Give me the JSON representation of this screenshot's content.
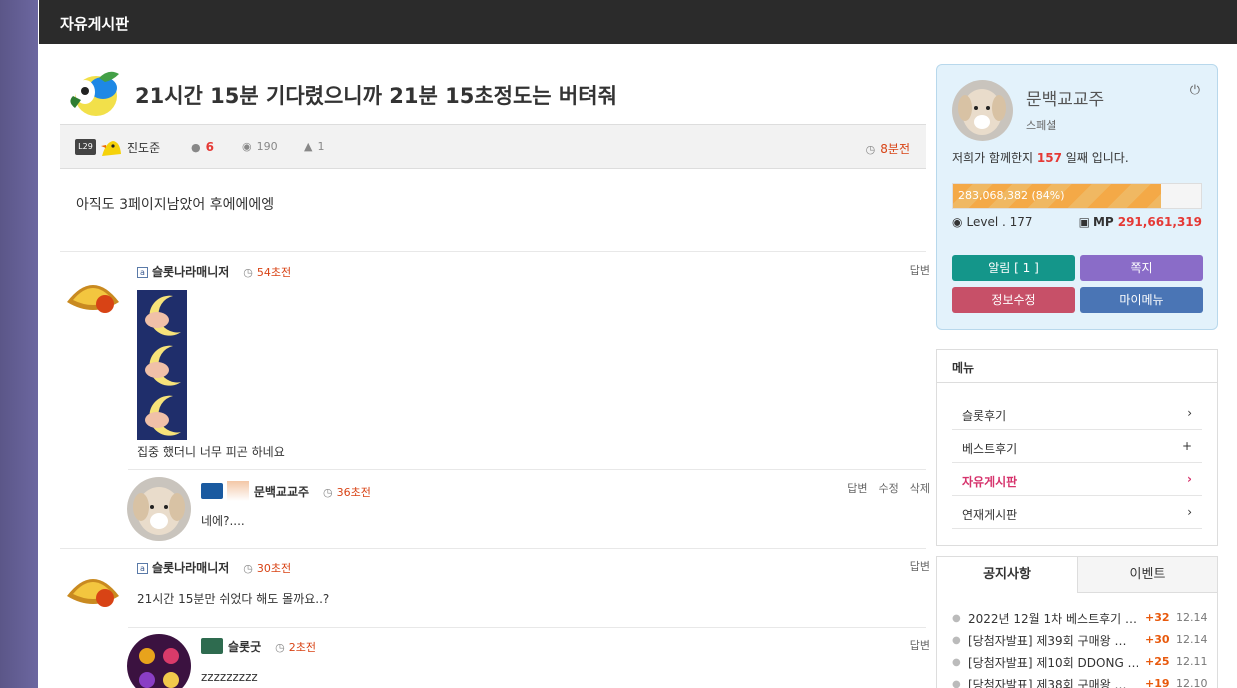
{
  "topbar": {
    "title": "자유게시판"
  },
  "post": {
    "title": "21시간 15분 기다렸으니까 21분 15초정도는 버텨줘",
    "level_badge": "L29",
    "author": "진도준",
    "comments": "6",
    "views": "190",
    "likes": "1",
    "time": "8분전",
    "body": "아직도 3페이지남았어 후에에에엥"
  },
  "comments": [
    {
      "author": "슬롯나라매니저",
      "time": "54초전",
      "reply": "답변",
      "text": "집중 했더니 너무 피곤 하네요"
    },
    {
      "author": "문백교교주",
      "time": "36초전",
      "reply": "답변",
      "edit": "수정",
      "delete": "삭제",
      "text": "네에?...."
    },
    {
      "author": "슬롯나라매니저",
      "time": "30초전",
      "reply": "답변",
      "text": "21시간 15분만 쉬었다 해도 몰까요..?"
    },
    {
      "author": "슬롯굿",
      "time": "2초전",
      "reply": "답변",
      "text": "zzzzzzzzz"
    }
  ],
  "profile": {
    "name": "문백교교주",
    "role": "스페셜",
    "days_prefix": "저희가 함께한지 ",
    "days": "157",
    "days_suffix": " 일째 입니다.",
    "exp_text": "283,068,382 (84%)",
    "exp_fraction": 0.84,
    "level_label": "Level . 177",
    "mp_label": "MP",
    "mp_value": "291,661,319",
    "buttons": {
      "alarm": "알림 [ 1 ]",
      "message": "쪽지",
      "edit": "정보수정",
      "mymenu": "마이메뉴"
    }
  },
  "menu": {
    "title": "메뉴",
    "items": [
      {
        "label": "슬롯후기",
        "mark": "›"
      },
      {
        "label": "베스트후기",
        "mark": "+"
      },
      {
        "label": "자유게시판",
        "mark": "›"
      },
      {
        "label": "연재게시판",
        "mark": "›"
      }
    ]
  },
  "notice": {
    "tabs": [
      "공지사항",
      "이벤트"
    ],
    "items": [
      {
        "title": "2022년 12월 1차 베스트후기 …",
        "count": "+32",
        "date": "12.14"
      },
      {
        "title": "[당첨자발표] 제39회 구매왕 …",
        "count": "+30",
        "date": "12.14"
      },
      {
        "title": "[당첨자발표] 제10회 DDONG …",
        "count": "+25",
        "date": "12.11"
      },
      {
        "title": "[당첨자발표] 제38회 구매왕 …",
        "count": "+19",
        "date": "12.10"
      }
    ]
  },
  "colors": {
    "topbar": "#2b2b2b",
    "accent_red": "#e53935",
    "time_orange": "#d84315",
    "btn_teal": "#14968a",
    "btn_purple": "#8a6cc8",
    "btn_pink": "#c75068",
    "btn_blue": "#4a75b5"
  }
}
